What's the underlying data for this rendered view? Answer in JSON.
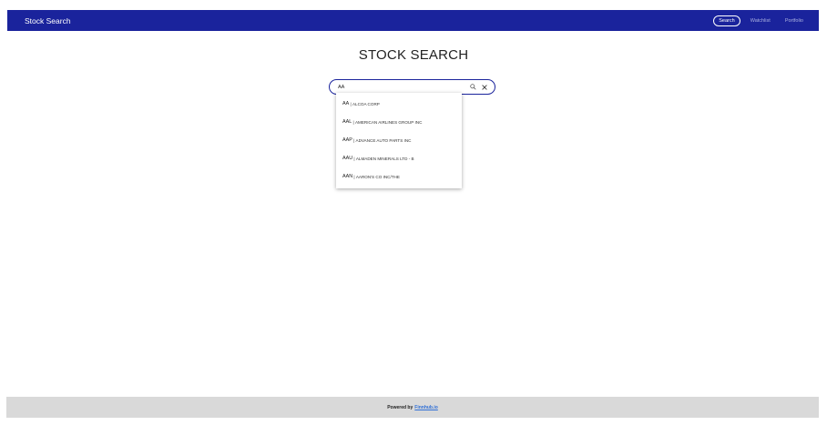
{
  "navbar": {
    "brand": "Stock Search",
    "links": [
      {
        "label": "Search",
        "active": true
      },
      {
        "label": "Watchlist",
        "active": false
      },
      {
        "label": "Portfolio",
        "active": false
      }
    ]
  },
  "main": {
    "title": "STOCK SEARCH"
  },
  "search": {
    "value": "AA",
    "search_icon": "search-icon",
    "clear_icon": "close-icon",
    "accent_color": "#1a239c"
  },
  "suggestions": [
    {
      "symbol": "AA",
      "name": "ALCOA CORP"
    },
    {
      "symbol": "AAL",
      "name": "AMERICAN AIRLINES GROUP INC"
    },
    {
      "symbol": "AAP",
      "name": "ADVANCE AUTO PARTS INC"
    },
    {
      "symbol": "AAU",
      "name": "ALMADEN MINERALS LTD - B"
    },
    {
      "symbol": "AAN",
      "name": "AARON'S CO INC/THE"
    }
  ],
  "footer": {
    "prefix": "Powered by",
    "link_text": "Finnhub.io"
  },
  "colors": {
    "navbar_bg": "#1a239c",
    "footer_bg": "#d9d9d9",
    "link": "#2f6fd6"
  }
}
